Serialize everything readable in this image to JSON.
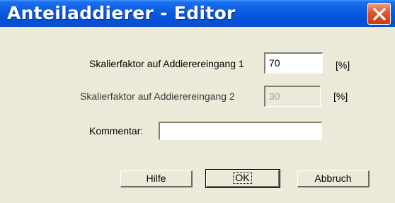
{
  "window": {
    "title": "Anteiladdierer - Editor",
    "close_icon": "close-icon"
  },
  "form": {
    "scale1_label": "Skalierfaktor auf Addierereingang 1",
    "scale1_value": "70",
    "scale1_unit": "[%]",
    "scale2_label": "Skalierfaktor auf Addierereingang 2",
    "scale2_value": "30",
    "scale2_unit": "[%]",
    "comment_label": "Kommentar:",
    "comment_value": ""
  },
  "buttons": {
    "help": "Hilfe",
    "ok": "OK",
    "cancel": "Abbruch"
  },
  "colors": {
    "titlebar": "#0a5ae0",
    "close": "#e2562f",
    "dialog_bg": "#ece9d8"
  }
}
